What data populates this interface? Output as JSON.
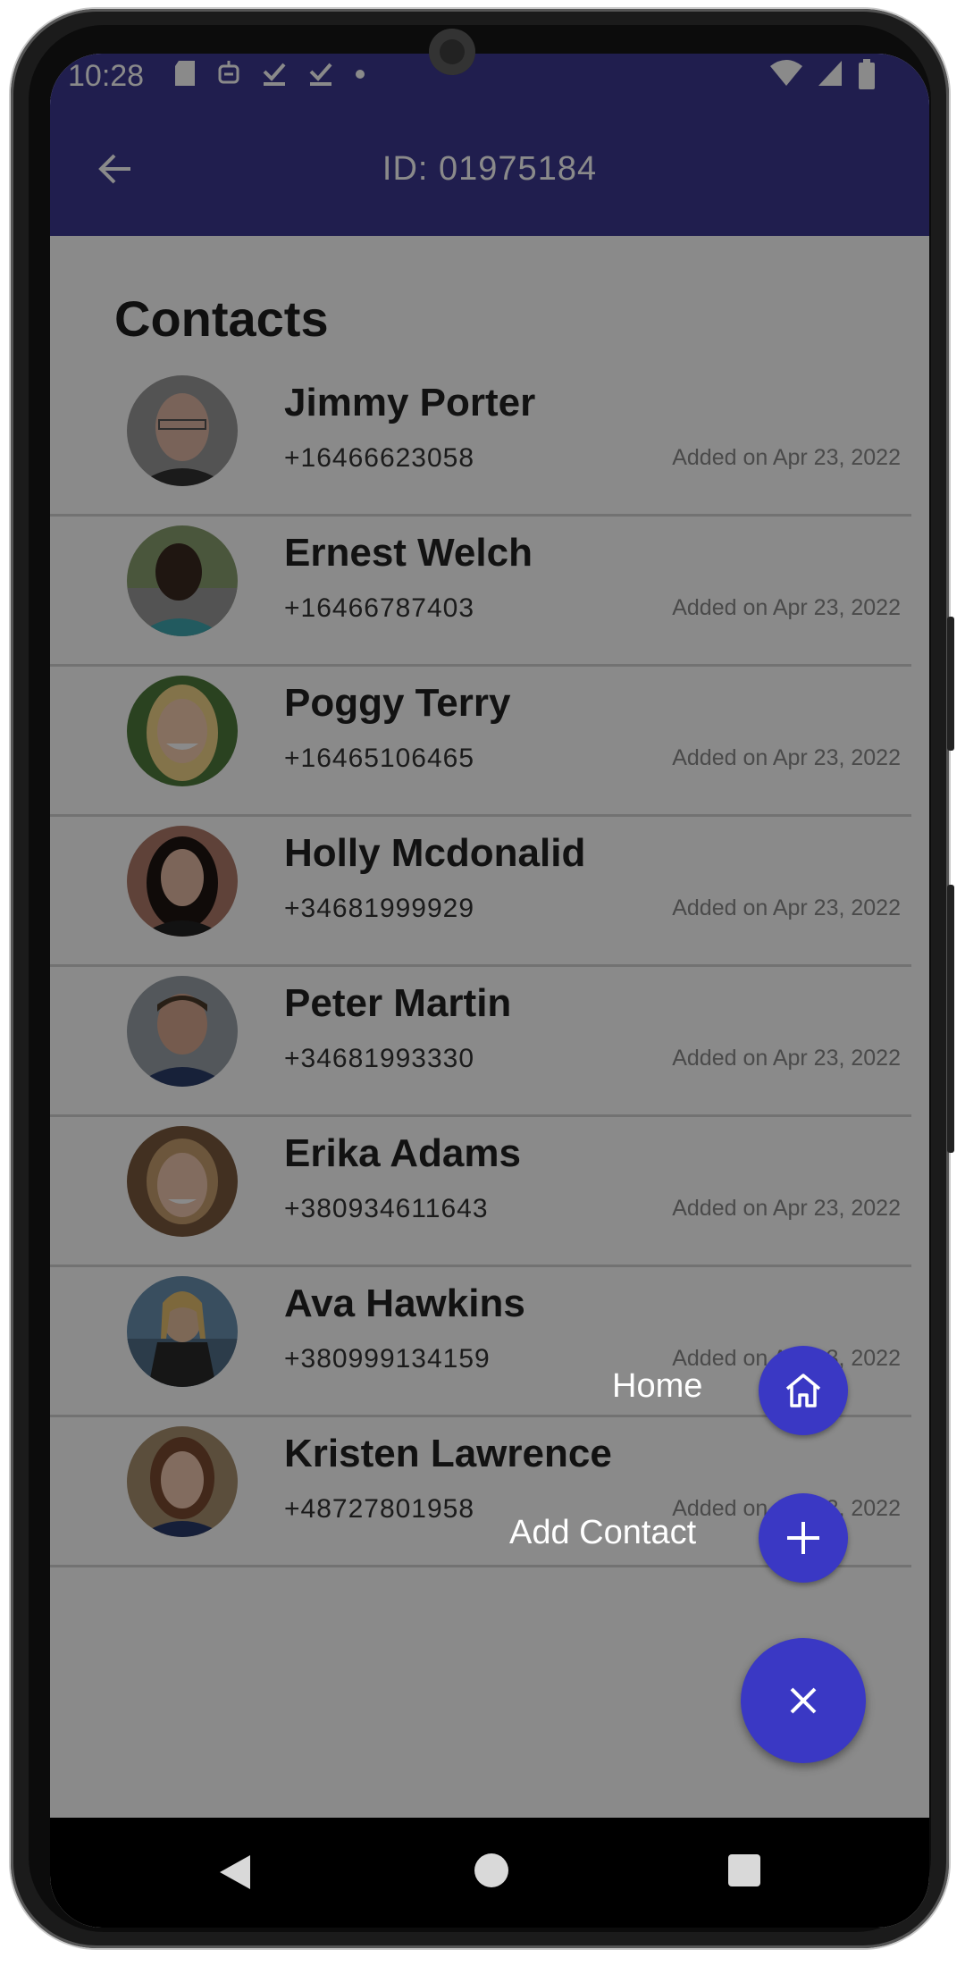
{
  "status": {
    "time": "10:28"
  },
  "appbar": {
    "title": "ID: 01975184"
  },
  "page": {
    "title": "Contacts"
  },
  "contacts": [
    {
      "name": "Jimmy Porter",
      "phone": "+16466623058",
      "added": "Added on Apr 23, 2022"
    },
    {
      "name": "Ernest Welch",
      "phone": "+16466787403",
      "added": "Added on Apr 23, 2022"
    },
    {
      "name": "Poggy Terry",
      "phone": "+16465106465",
      "added": "Added on Apr 23, 2022"
    },
    {
      "name": "Holly Mcdonalid",
      "phone": "+34681999929",
      "added": "Added on Apr 23, 2022"
    },
    {
      "name": "Peter Martin",
      "phone": "+34681993330",
      "added": "Added on Apr 23, 2022"
    },
    {
      "name": "Erika Adams",
      "phone": "+380934611643",
      "added": "Added on Apr 23, 2022"
    },
    {
      "name": "Ava Hawkins",
      "phone": "+380999134159",
      "added": "Added on Apr 23, 2022"
    },
    {
      "name": "Kristen  Lawrence",
      "phone": "+48727801958",
      "added": "Added on Apr 23, 2022"
    }
  ],
  "fab_menu": {
    "home_label": "Home",
    "add_contact_label": "Add Contact",
    "home_icon": "home-icon",
    "add_icon": "plus-icon",
    "close_icon": "close-icon"
  },
  "colors": {
    "primary": "#3c3890",
    "fab": "#3a38c4",
    "scrim": "rgba(0,0,0,0.46)"
  }
}
